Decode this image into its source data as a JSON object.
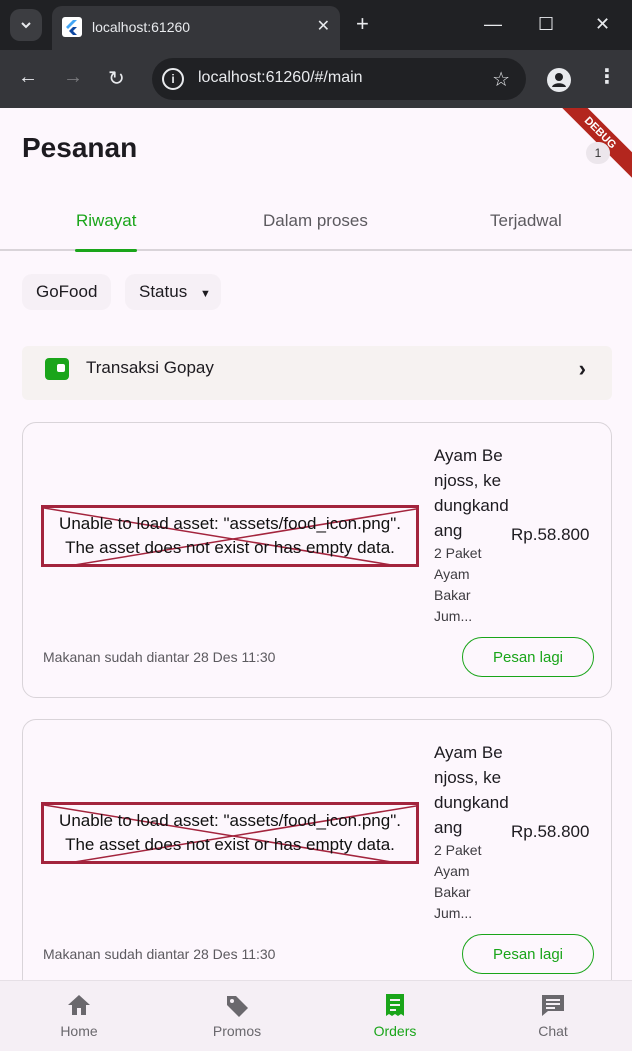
{
  "browser": {
    "tab_title": "localhost:61260",
    "url": "localhost:61260/#/main",
    "icons": [
      "tab-search-icon",
      "flutter-icon",
      "close-icon",
      "new-tab-icon",
      "minimize-icon",
      "maximize-icon",
      "close-window-icon",
      "back-icon",
      "forward-icon",
      "reload-icon",
      "info-icon",
      "star-icon",
      "profile-icon",
      "menu-icon"
    ]
  },
  "app": {
    "debug_label": "DEBUG",
    "title": "Pesanan",
    "badge": "1",
    "tabs": [
      "Riwayat",
      "Dalam proses",
      "Terjadwal"
    ],
    "filters": {
      "gofood": "GoFood",
      "status": "Status"
    },
    "gopay": {
      "label": "Transaksi Gopay"
    },
    "orders": [
      {
        "error_line1": "Unable to load asset: \"assets/food_icon.png\".",
        "error_line2": "The asset does not exist or has empty data.",
        "name": "Ayam Benjoss, kedungkandang",
        "desc": "2 Paket Ayam Bakar Jum...",
        "price": "Rp.58.800",
        "status": "Makanan sudah diantar 28 Des 11:30",
        "button": "Pesan lagi"
      },
      {
        "error_line1": "Unable to load asset: \"assets/food_icon.png\".",
        "error_line2": "The asset does not exist or has empty data.",
        "name": "Ayam Benjoss, kedungkandang",
        "desc": "2 Paket Ayam Bakar Jum...",
        "price": "Rp.58.800",
        "status": "Makanan sudah diantar 28 Des 11:30",
        "button": "Pesan lagi"
      }
    ],
    "bottom_nav": [
      {
        "label": "Home",
        "icon": "home-icon"
      },
      {
        "label": "Promos",
        "icon": "tag-icon"
      },
      {
        "label": "Orders",
        "icon": "receipt-icon"
      },
      {
        "label": "Chat",
        "icon": "chat-icon"
      }
    ],
    "accent_color": "#1aa51a"
  }
}
